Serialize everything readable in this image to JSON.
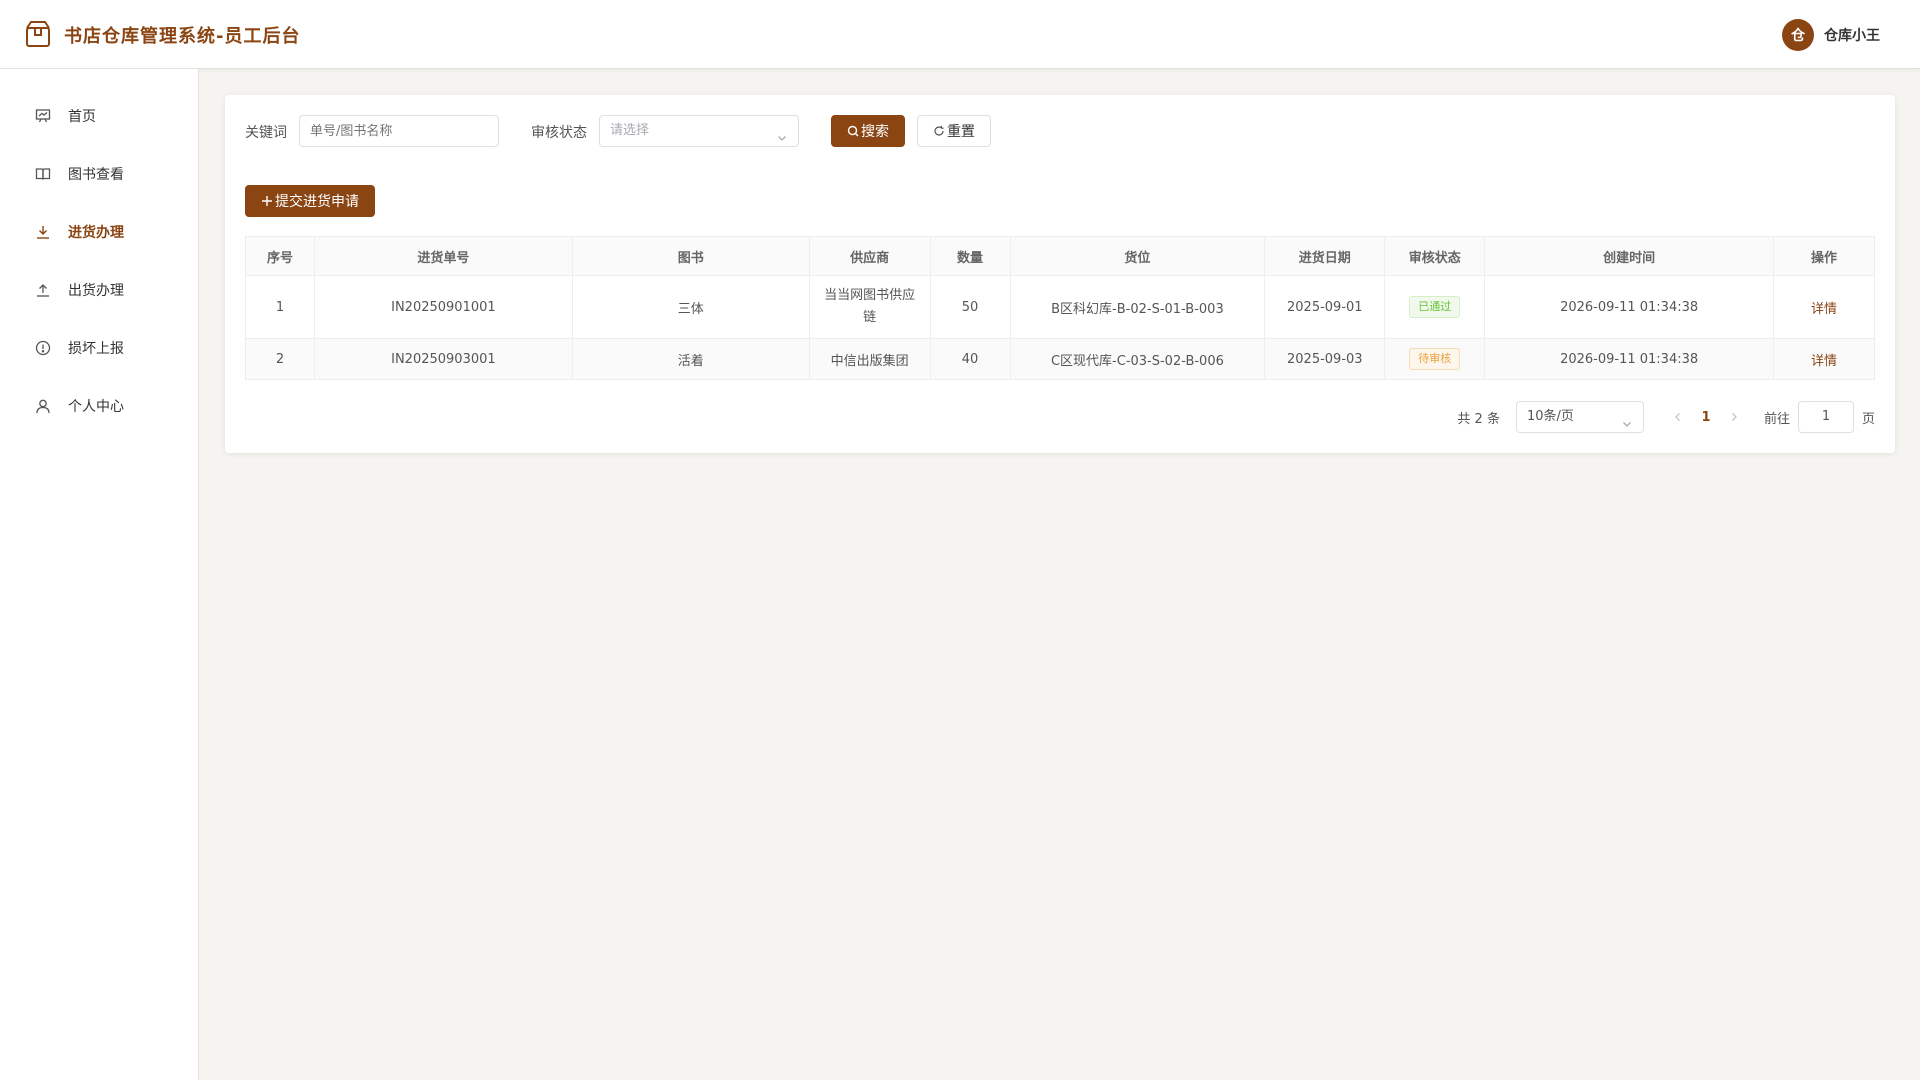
{
  "header": {
    "title": "书店仓库管理系统-员工后台",
    "avatar_text": "仓",
    "user_name": "仓库小王",
    "icon": "box-icon"
  },
  "sidebar": {
    "items": [
      {
        "label": "首页",
        "icon": "dashboard-icon",
        "active": false
      },
      {
        "label": "图书查看",
        "icon": "book-icon",
        "active": false
      },
      {
        "label": "进货办理",
        "icon": "download-icon",
        "active": true
      },
      {
        "label": "出货办理",
        "icon": "upload-icon",
        "active": false
      },
      {
        "label": "损坏上报",
        "icon": "warning-icon",
        "active": false
      },
      {
        "label": "个人中心",
        "icon": "user-icon",
        "active": false
      }
    ]
  },
  "filters": {
    "keyword_label": "关键词",
    "keyword_placeholder": "单号/图书名称",
    "status_label": "审核状态",
    "status_placeholder": "请选择",
    "search_label": "搜索",
    "reset_label": "重置"
  },
  "actions": {
    "submit_label": "提交进货申请"
  },
  "table": {
    "columns": [
      "序号",
      "进货单号",
      "图书",
      "供应商",
      "数量",
      "货位",
      "进货日期",
      "审核状态",
      "创建时间",
      "操作"
    ],
    "rows": [
      {
        "index": "1",
        "order_no": "IN20250901001",
        "book": "三体",
        "supplier": "当当网图书供应链",
        "qty": "50",
        "location": "B区科幻库-B-02-S-01-B-003",
        "date": "2025-09-01",
        "status": "已通过",
        "created": "2026-09-11 01:34:38",
        "action": "详情"
      },
      {
        "index": "2",
        "order_no": "IN20250903001",
        "book": "活着",
        "supplier": "中信出版集团",
        "qty": "40",
        "location": "C区现代库-C-03-S-02-B-006",
        "date": "2025-09-03",
        "status": "待审核",
        "created": "2026-09-11 01:34:38",
        "action": "详情"
      }
    ]
  },
  "pagination": {
    "total_text": "共 2 条",
    "page_size": "10条/页",
    "current_page": "1",
    "goto_label": "前往",
    "goto_value": "1",
    "page_unit": "页"
  },
  "colors": {
    "brand": "#8b4513",
    "approved": "#67c23a",
    "pending": "#e6a23c"
  }
}
